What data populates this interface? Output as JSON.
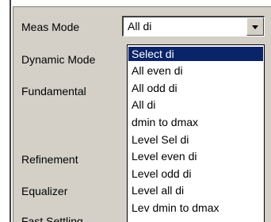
{
  "form": {
    "labels": {
      "meas_mode": "Meas Mode",
      "dynamic_mode": "Dynamic Mode",
      "fundamental": "Fundamental",
      "refinement": "Refinement",
      "equalizer": "Equalizer",
      "fast_settling": "Fast Settling"
    },
    "meas_mode_select": {
      "value": "All di"
    }
  },
  "dropdown": {
    "items": [
      "Select di",
      "All even di",
      "All odd di",
      "All di",
      "dmin to dmax",
      "Level Sel di",
      "Level even di",
      "Level odd di",
      "Level all di",
      "Lev dmin to dmax"
    ],
    "highlighted": "Select di"
  },
  "colors": {
    "panel": "#d4d0c8",
    "selection": "#0a246a",
    "selection_text": "#ffffff"
  }
}
